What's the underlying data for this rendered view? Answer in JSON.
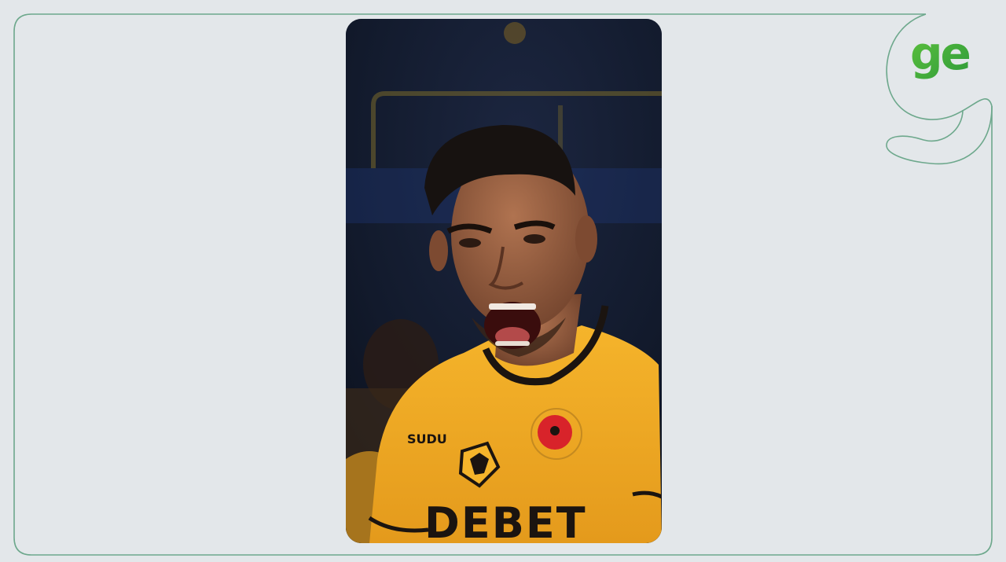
{
  "brand": {
    "logo_text": "ge",
    "accent_color": "#3fae3a",
    "outline_color": "#5f9c7e"
  },
  "photo": {
    "jersey_sponsor": "DEBET",
    "kit_maker": "SUDU",
    "kit_color": "#f1aa25",
    "badge_icon": "wolf-crest-icon",
    "poppy_icon": "poppy-icon"
  }
}
